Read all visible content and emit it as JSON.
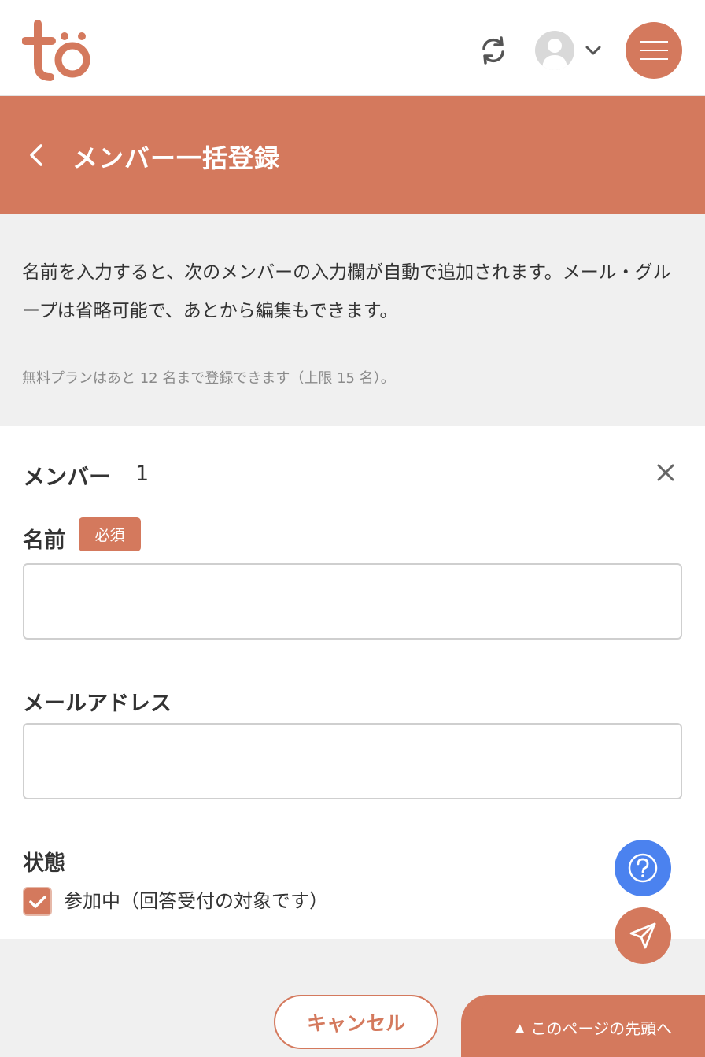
{
  "header": {
    "logo_text": "tö",
    "page_title": "メンバー一括登録"
  },
  "intro": {
    "text": "名前を入力すると、次のメンバーの入力欄が自動で追加されます。メール・グループは省略可能で、あとから編集もできます。",
    "plan_note": "無料プランはあと 12 名まで登録できます（上限 15 名）。"
  },
  "member_card": {
    "heading": "メンバー",
    "number": "1",
    "name_label": "名前",
    "required_badge": "必須",
    "name_value": "",
    "email_label": "メールアドレス",
    "email_value": "",
    "status_label": "状態",
    "status_checkbox_label": "参加中（回答受付の対象です）",
    "status_checked": true
  },
  "footer": {
    "cancel_label": "キャンセル",
    "to_top_label": "このページの先頭へ",
    "to_top_arrow": "▲"
  },
  "icons": {
    "sync": "sync-icon",
    "avatar": "user-avatar-icon",
    "chevron": "chevron-down-icon",
    "menu": "hamburger-menu-icon",
    "back": "chevron-left-icon",
    "close": "close-icon",
    "check": "check-icon",
    "help": "question-mark-icon",
    "send": "paper-plane-icon"
  },
  "colors": {
    "accent": "#d4795d",
    "help_blue": "#4b82ef",
    "background": "#f0f0f0",
    "card": "#ffffff"
  }
}
